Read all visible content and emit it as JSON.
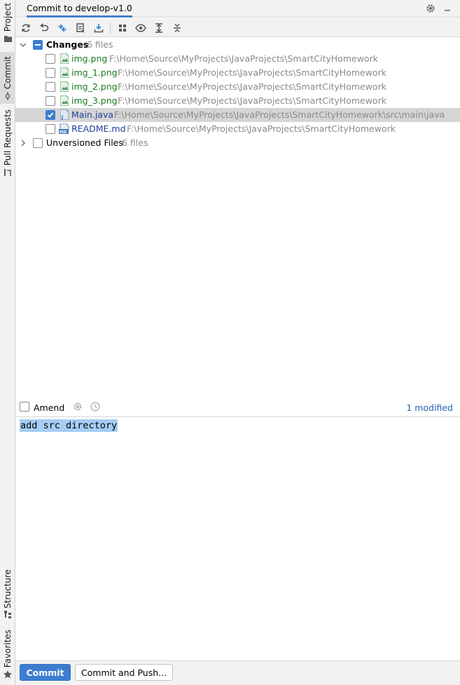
{
  "sidebar": {
    "project": "Project",
    "commit": "Commit",
    "pull_requests": "Pull Requests",
    "structure": "Structure",
    "favorites": "Favorites"
  },
  "header": {
    "title": "Commit to develop-v1.0"
  },
  "toolbar": {
    "buttons": [
      "refresh-icon",
      "rollback-icon",
      "diff-icon",
      "changelist-icon",
      "shelve-icon",
      "group-by-icon",
      "view-options-icon",
      "expand-all-icon",
      "collapse-all-icon"
    ]
  },
  "tree": {
    "changes": {
      "label": "Changes",
      "count": "6 files",
      "files": [
        {
          "name": "img.png",
          "path": "F:\\Home\\Source\\MyProjects\\JavaProjects\\SmartCityHomework",
          "checked": false
        },
        {
          "name": "img_1.png",
          "path": "F:\\Home\\Source\\MyProjects\\JavaProjects\\SmartCityHomework",
          "checked": false
        },
        {
          "name": "img_2.png",
          "path": "F:\\Home\\Source\\MyProjects\\JavaProjects\\SmartCityHomework",
          "checked": false
        },
        {
          "name": "img_3.png",
          "path": "F:\\Home\\Source\\MyProjects\\JavaProjects\\SmartCityHomework",
          "checked": false
        },
        {
          "name": "Main.java",
          "path": "F:\\Home\\Source\\MyProjects\\JavaProjects\\SmartCityHomework\\src\\main\\java",
          "checked": true
        },
        {
          "name": "README.md",
          "path": "F:\\Home\\Source\\MyProjects\\JavaProjects\\SmartCityHomework",
          "checked": false
        }
      ]
    },
    "unversioned": {
      "label": "Unversioned Files",
      "count": "6 files"
    }
  },
  "amend": {
    "label": "Amend",
    "modified": "1 modified"
  },
  "message": {
    "text": "add src directory"
  },
  "buttons": {
    "commit": "Commit",
    "commit_and_push": "Commit and Push..."
  },
  "colors": {
    "accent": "#3d7dd0",
    "added_file": "#1a7a1a",
    "modified_file": "#1d3f9b"
  }
}
